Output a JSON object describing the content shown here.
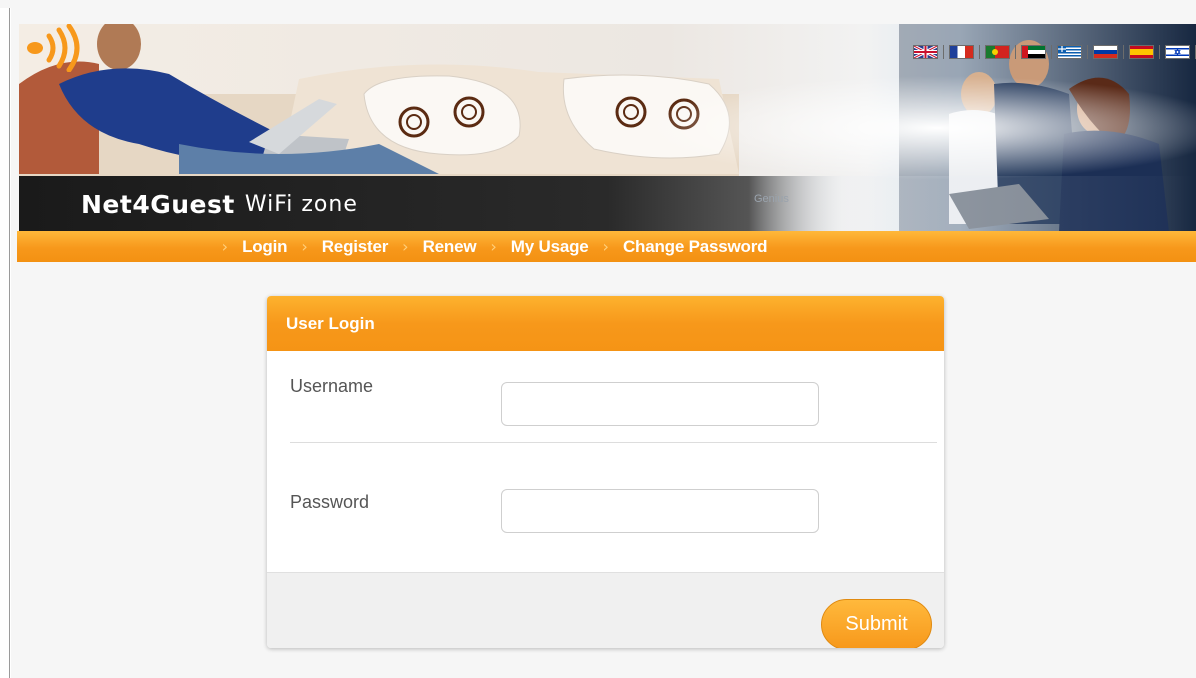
{
  "banner": {
    "brand_name": "Net4Guest",
    "brand_sub": "WiFi zone",
    "faded_text": "Genius",
    "languages": [
      "english-flag-icon",
      "french-flag-icon",
      "portuguese-flag-icon",
      "uae-flag-icon",
      "greek-flag-icon",
      "russian-flag-icon",
      "spanish-flag-icon",
      "israeli-flag-icon"
    ]
  },
  "nav": {
    "items": [
      {
        "label": "Login"
      },
      {
        "label": "Register"
      },
      {
        "label": "Renew"
      },
      {
        "label": "My Usage"
      },
      {
        "label": "Change Password"
      }
    ]
  },
  "login": {
    "title": "User Login",
    "username_label": "Username",
    "username_value": "",
    "password_label": "Password",
    "password_value": "",
    "submit_label": "Submit"
  },
  "colors": {
    "accent": "#f7981b",
    "accent_light": "#ffb83a",
    "page_bg": "#f6f6f6"
  }
}
